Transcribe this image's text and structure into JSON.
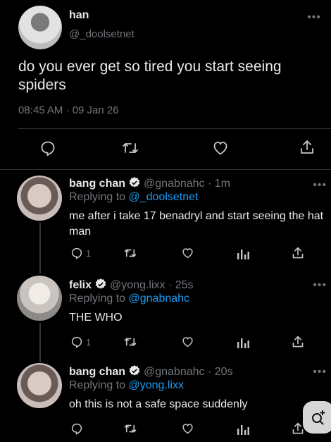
{
  "main_tweet": {
    "name": "han",
    "handle": "@_doolsetnet",
    "text": "do you ever get so tired you start seeing spiders",
    "timestamp": "08:45 AM · 09 Jan 26"
  },
  "replies": [
    {
      "name": "bang chan",
      "handle": "@gnabnahc",
      "time": "· 1m",
      "replying_prefix": "Replying to",
      "replying_to": "@_doolsetnet",
      "text": "me after i take 17 benadryl and start seeing the hat man",
      "reply_count": "1"
    },
    {
      "name": "felix",
      "handle": "@yong.lixx",
      "time": "· 25s",
      "replying_prefix": "Replying to",
      "replying_to": "@gnabnahc",
      "text": "THE WHO",
      "reply_count": "1"
    },
    {
      "name": "bang chan",
      "handle": "@gnabnahc",
      "time": "· 20s",
      "replying_prefix": "Replying to",
      "replying_to": "@yong.lixx",
      "text": "oh this is not a safe space suddenly",
      "reply_count": ""
    }
  ],
  "icons": {
    "reply": "reply-icon",
    "retweet": "retweet-icon",
    "like": "heart-icon",
    "views": "views-icon",
    "share": "share-icon",
    "verified": "verified-badge-icon",
    "more": "more-icon",
    "compose": "compose-sparkle-icon"
  },
  "colors": {
    "background": "#000000",
    "text": "#e7e9ea",
    "muted": "#71767b",
    "link": "#1d9bf0",
    "divider": "#2f3336"
  }
}
